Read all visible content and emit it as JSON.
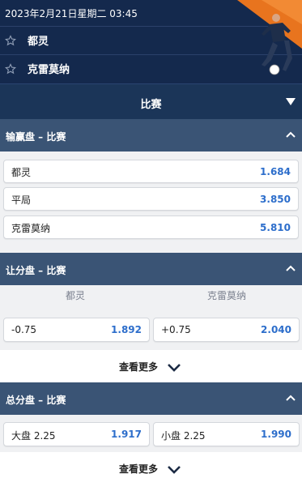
{
  "event": {
    "datetime": "2023年2月21日星期二 03:45",
    "home": "都灵",
    "away": "克雷莫纳"
  },
  "main_tab": {
    "label": "比赛"
  },
  "moneyline": {
    "title": "输赢盘 – 比赛",
    "rows": [
      {
        "name": "都灵",
        "odd": "1.684"
      },
      {
        "name": "平局",
        "odd": "3.850"
      },
      {
        "name": "克雷莫纳",
        "odd": "5.810"
      }
    ]
  },
  "handicap": {
    "title": "让分盘 – 比赛",
    "col_home": "都灵",
    "col_away": "克雷莫纳",
    "home": {
      "line": "-0.75",
      "odd": "1.892"
    },
    "away": {
      "line": "+0.75",
      "odd": "2.040"
    },
    "more": "查看更多"
  },
  "totals": {
    "title": "总分盘 – 比赛",
    "over": {
      "line": "大盘 2.25",
      "odd": "1.917"
    },
    "under": {
      "line": "小盘 2.25",
      "odd": "1.990"
    },
    "more": "查看更多"
  },
  "colors": {
    "header_bg": "#14294d",
    "section_bg": "#3a5475",
    "odd_text": "#2d6ecb",
    "accent_orange": "#e8741e"
  },
  "icons": [
    "star-outline-icon",
    "caret-down-icon",
    "chevron-up-icon",
    "chevron-down-icon",
    "soccer-player-illustration"
  ]
}
